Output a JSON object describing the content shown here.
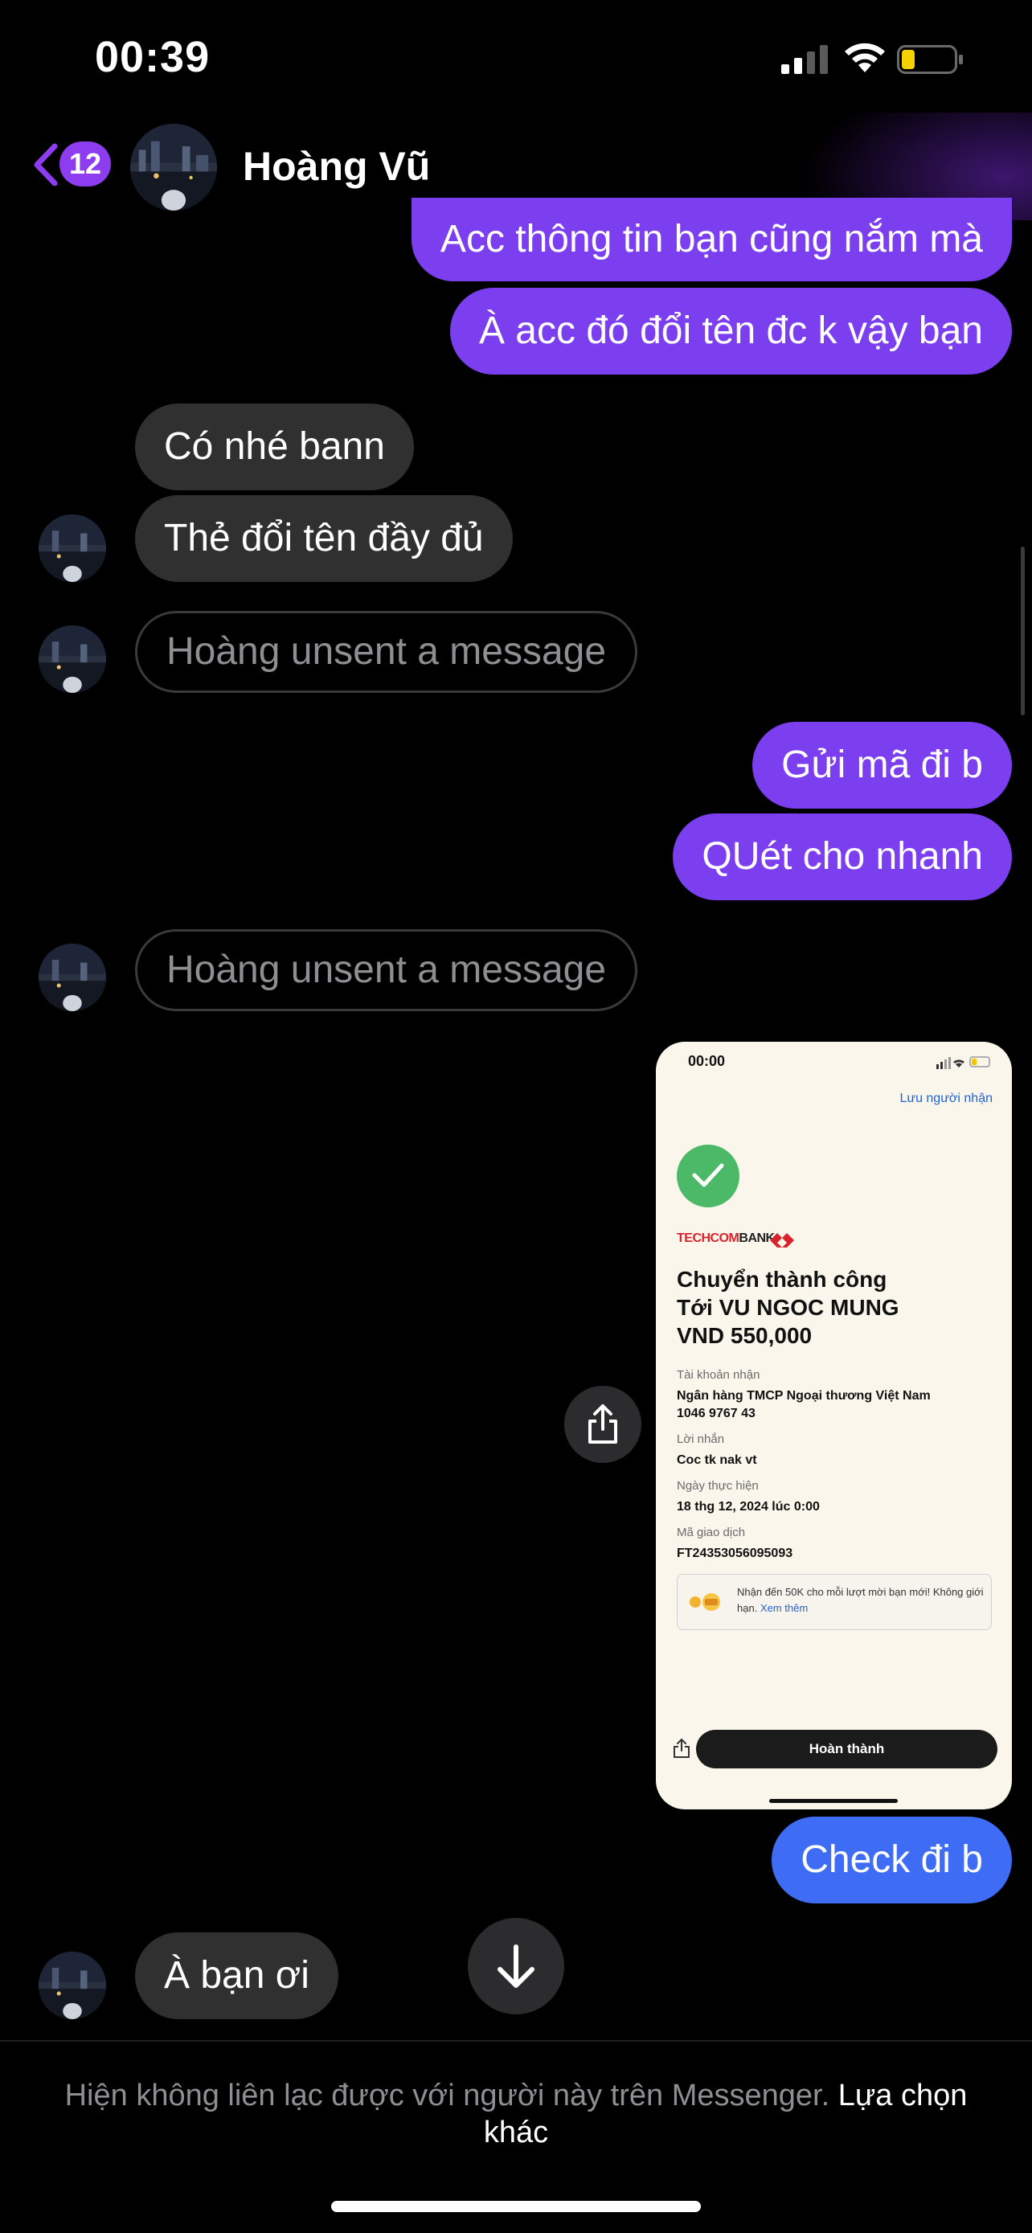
{
  "status_bar": {
    "time": "00:39"
  },
  "header": {
    "back_count": "12",
    "contact_name": "Hoàng Vũ"
  },
  "messages": {
    "m1": "Acc thông tin bạn cũng nắm mà",
    "m2": "À acc đó đổi tên đc k vậy bạn",
    "m3": "Có nhé bann",
    "m4": "Thẻ đổi tên đầy đủ",
    "m5": "Hoàng unsent a message",
    "m6": "Gửi mã đi b",
    "m7": "QUét cho nhanh",
    "m8": "Hoàng unsent a message",
    "m9": "Check đi b",
    "m10": "À bạn ơi"
  },
  "receipt": {
    "time": "00:00",
    "save_recipient": "Lưu người nhận",
    "bank_logo_red": "TECHCOM",
    "bank_logo_dark": "BANK",
    "title_line1": "Chuyển thành công",
    "title_line2": "Tới VU NGOC MUNG",
    "title_line3": "VND 550,000",
    "account_label": "Tài khoản nhận",
    "account_bank": "Ngân hàng TMCP Ngoại thương Việt Nam",
    "account_number": "1046 9767 43",
    "message_label": "Lời nhắn",
    "message_value": "Coc tk nak vt",
    "date_label": "Ngày thực hiện",
    "date_value": "18 thg 12, 2024 lúc 0:00",
    "txn_label": "Mã giao dịch",
    "txn_value": "FT24353056095093",
    "promo_text": "Nhận đến 50K cho mỗi lượt mời bạn mới! Không giới hạn.",
    "promo_link": "Xem thêm",
    "done_button": "Hoàn thành"
  },
  "footer": {
    "notice": "Hiện không liên lạc được với người này trên Messenger.",
    "link": "Lựa chọn khác"
  },
  "icons": {
    "back": "chevron-left-icon",
    "share": "share-icon",
    "scroll": "arrow-down-icon",
    "check": "check-icon"
  },
  "colors": {
    "outgoing_bubble": "#7b3ff0",
    "outgoing_bubble_latest": "#3f6cf4",
    "incoming_bubble": "#303030",
    "badge": "#8e3cf0",
    "success_green": "#4cb968"
  }
}
